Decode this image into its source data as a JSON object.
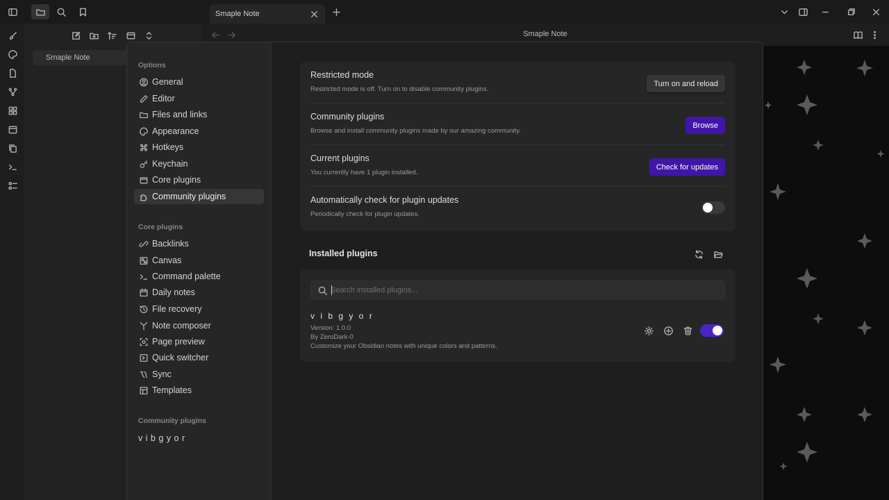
{
  "window": {
    "tab_title": "Smaple Note",
    "editor_title": "Smaple Note"
  },
  "explorer": {
    "note": "Smaple Note"
  },
  "sidebar": {
    "options_title": "Options",
    "options": [
      {
        "label": "General",
        "icon": "gear-circle-icon"
      },
      {
        "label": "Editor",
        "icon": "pencil-icon"
      },
      {
        "label": "Files and links",
        "icon": "folder-icon"
      },
      {
        "label": "Appearance",
        "icon": "palette-icon"
      },
      {
        "label": "Hotkeys",
        "icon": "command-icon"
      },
      {
        "label": "Keychain",
        "icon": "key-icon"
      },
      {
        "label": "Core plugins",
        "icon": "plug-icon"
      },
      {
        "label": "Community plugins",
        "icon": "puzzle-icon"
      }
    ],
    "core_title": "Core plugins",
    "core": [
      {
        "label": "Backlinks",
        "icon": "link-icon"
      },
      {
        "label": "Canvas",
        "icon": "canvas-icon"
      },
      {
        "label": "Command palette",
        "icon": "terminal-icon"
      },
      {
        "label": "Daily notes",
        "icon": "calendar-icon"
      },
      {
        "label": "File recovery",
        "icon": "history-icon"
      },
      {
        "label": "Note composer",
        "icon": "merge-icon"
      },
      {
        "label": "Page preview",
        "icon": "preview-icon"
      },
      {
        "label": "Quick switcher",
        "icon": "switch-icon"
      },
      {
        "label": "Sync",
        "icon": "sync-icon"
      },
      {
        "label": "Templates",
        "icon": "template-icon"
      }
    ],
    "community_title": "Community plugins",
    "community": [
      {
        "label": "v i b g y o r"
      }
    ]
  },
  "settings": {
    "restricted": {
      "name": "Restricted mode",
      "desc": "Restricted mode is off. Turn on to disable community plugins.",
      "button": "Turn on and reload"
    },
    "community": {
      "name": "Community plugins",
      "desc": "Browse and install community plugins made by our amazing community.",
      "button": "Browse"
    },
    "current": {
      "name": "Current plugins",
      "desc": "You currently have 1 plugin installed.",
      "button": "Check for updates"
    },
    "auto_check": {
      "name": "Automatically check for plugin updates",
      "desc": "Periodically check for plugin updates.",
      "enabled": false
    }
  },
  "installed": {
    "title": "Installed plugins",
    "search_placeholder": "Search installed plugins...",
    "search_value": "",
    "plugins": [
      {
        "name": "v i b g y o r",
        "version": "Version: 1.0.0",
        "author": "By ZeroDark-0",
        "desc": "Customize your Obsidian notes with unique colors and patterns.",
        "enabled": true
      }
    ]
  },
  "colors": {
    "accent": "#3f17a6",
    "toggle_on": "#4b25c4"
  }
}
